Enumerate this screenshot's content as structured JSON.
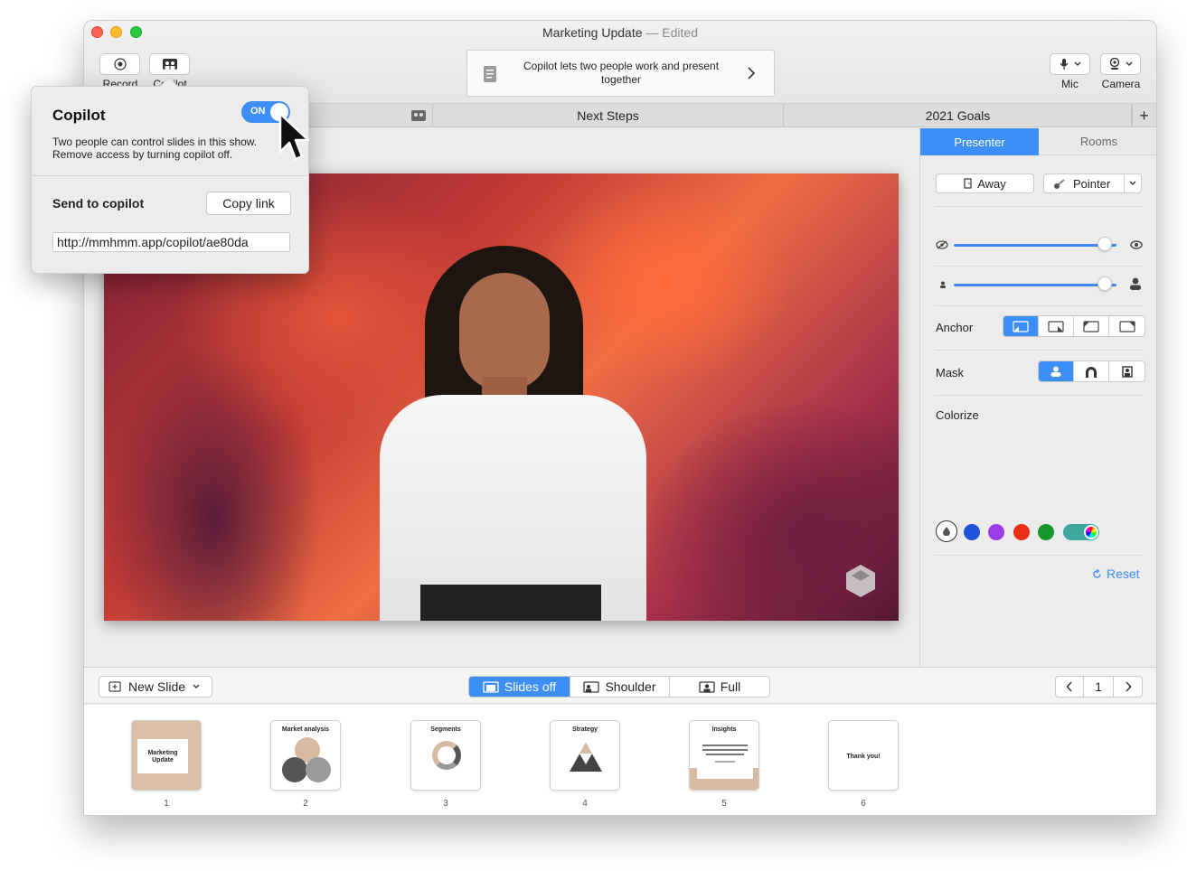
{
  "window": {
    "title": "Marketing Update",
    "title_suffix": "— Edited"
  },
  "toolbar": {
    "record_label": "Record",
    "copilot_label": "Copilot",
    "notice_text": "Copilot lets two people work and present together",
    "mic_label": "Mic",
    "camera_label": "Camera"
  },
  "tabs": [
    {
      "label": ""
    },
    {
      "label": "Next Steps"
    },
    {
      "label": "2021 Goals"
    }
  ],
  "popover": {
    "title": "Copilot",
    "toggle_label": "ON",
    "description": "Two people can control slides in this show. Remove access by turning copilot off.",
    "send_label": "Send to copilot",
    "copy_button": "Copy link",
    "link_value": "http://mmhmm.app/copilot/ae80da"
  },
  "panel": {
    "tabs": [
      {
        "label": "Presenter",
        "active": true
      },
      {
        "label": "Rooms",
        "active": false
      }
    ],
    "away_button": "Away",
    "pointer_button": "Pointer",
    "opacity_level": 0.93,
    "size_level": 0.93,
    "anchor_label": "Anchor",
    "mask_label": "Mask",
    "colorize_label": "Colorize",
    "reset_label": "Reset",
    "swatches": [
      "#ffffff",
      "#1f54d8",
      "#9b3de6",
      "#ee2d16",
      "#17962e"
    ]
  },
  "bottombar": {
    "new_slide": "New Slide",
    "views": [
      {
        "label": "Slides off",
        "active": true
      },
      {
        "label": "Shoulder",
        "active": false
      },
      {
        "label": "Full",
        "active": false
      }
    ],
    "page_number": "1"
  },
  "slides": [
    {
      "num": "1",
      "title": "Marketing Update"
    },
    {
      "num": "2",
      "title": "Market analysis"
    },
    {
      "num": "3",
      "title": "Segments"
    },
    {
      "num": "4",
      "title": "Strategy"
    },
    {
      "num": "5",
      "title": "Insights"
    },
    {
      "num": "6",
      "title": "Thank you!"
    }
  ],
  "colors": {
    "accent": "#3e8ef7"
  }
}
